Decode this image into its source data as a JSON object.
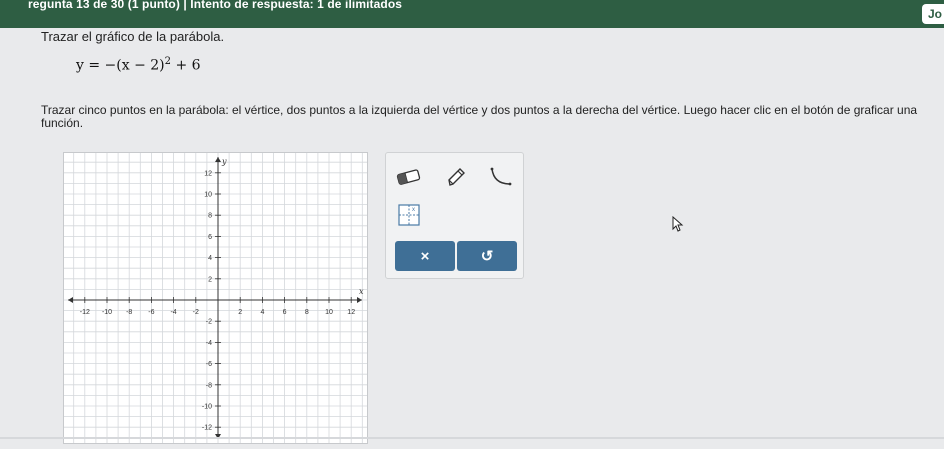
{
  "header": {
    "progress_text": "regunta 13 de 30 (1 punto)  |  Intento de respuesta: 1 de ilimitados",
    "user_tab": "Jo"
  },
  "question": {
    "instruction": "Trazar el gráfico de la parábola.",
    "equation_main": "y = −(x − 2)",
    "equation_exponent": "2",
    "equation_tail": " + 6",
    "task_text": "Trazar cinco puntos en la parábola: el vértice, dos puntos a la izquierda del vértice y dos puntos a la derecha del vértice. Luego hacer clic en el botón de graficar una función."
  },
  "graph": {
    "x_axis_label": "x",
    "y_axis_label": "y",
    "x_ticks": [
      "-12",
      "-10",
      "-8",
      "-6",
      "-4",
      "-2",
      "2",
      "4",
      "6",
      "8",
      "10",
      "12"
    ],
    "y_ticks": [
      "12",
      "10",
      "8",
      "6",
      "4",
      "2",
      "-2",
      "-4",
      "-6",
      "-8",
      "-10",
      "-12"
    ]
  },
  "toolbox": {
    "tools": [
      "eraser-icon",
      "pencil-icon",
      "parabola-icon",
      "graph-function-icon"
    ],
    "clear_label": "×",
    "undo_label": "↺"
  },
  "colors": {
    "header_bg": "#2e5e43",
    "button_bg": "#3f6f96"
  }
}
